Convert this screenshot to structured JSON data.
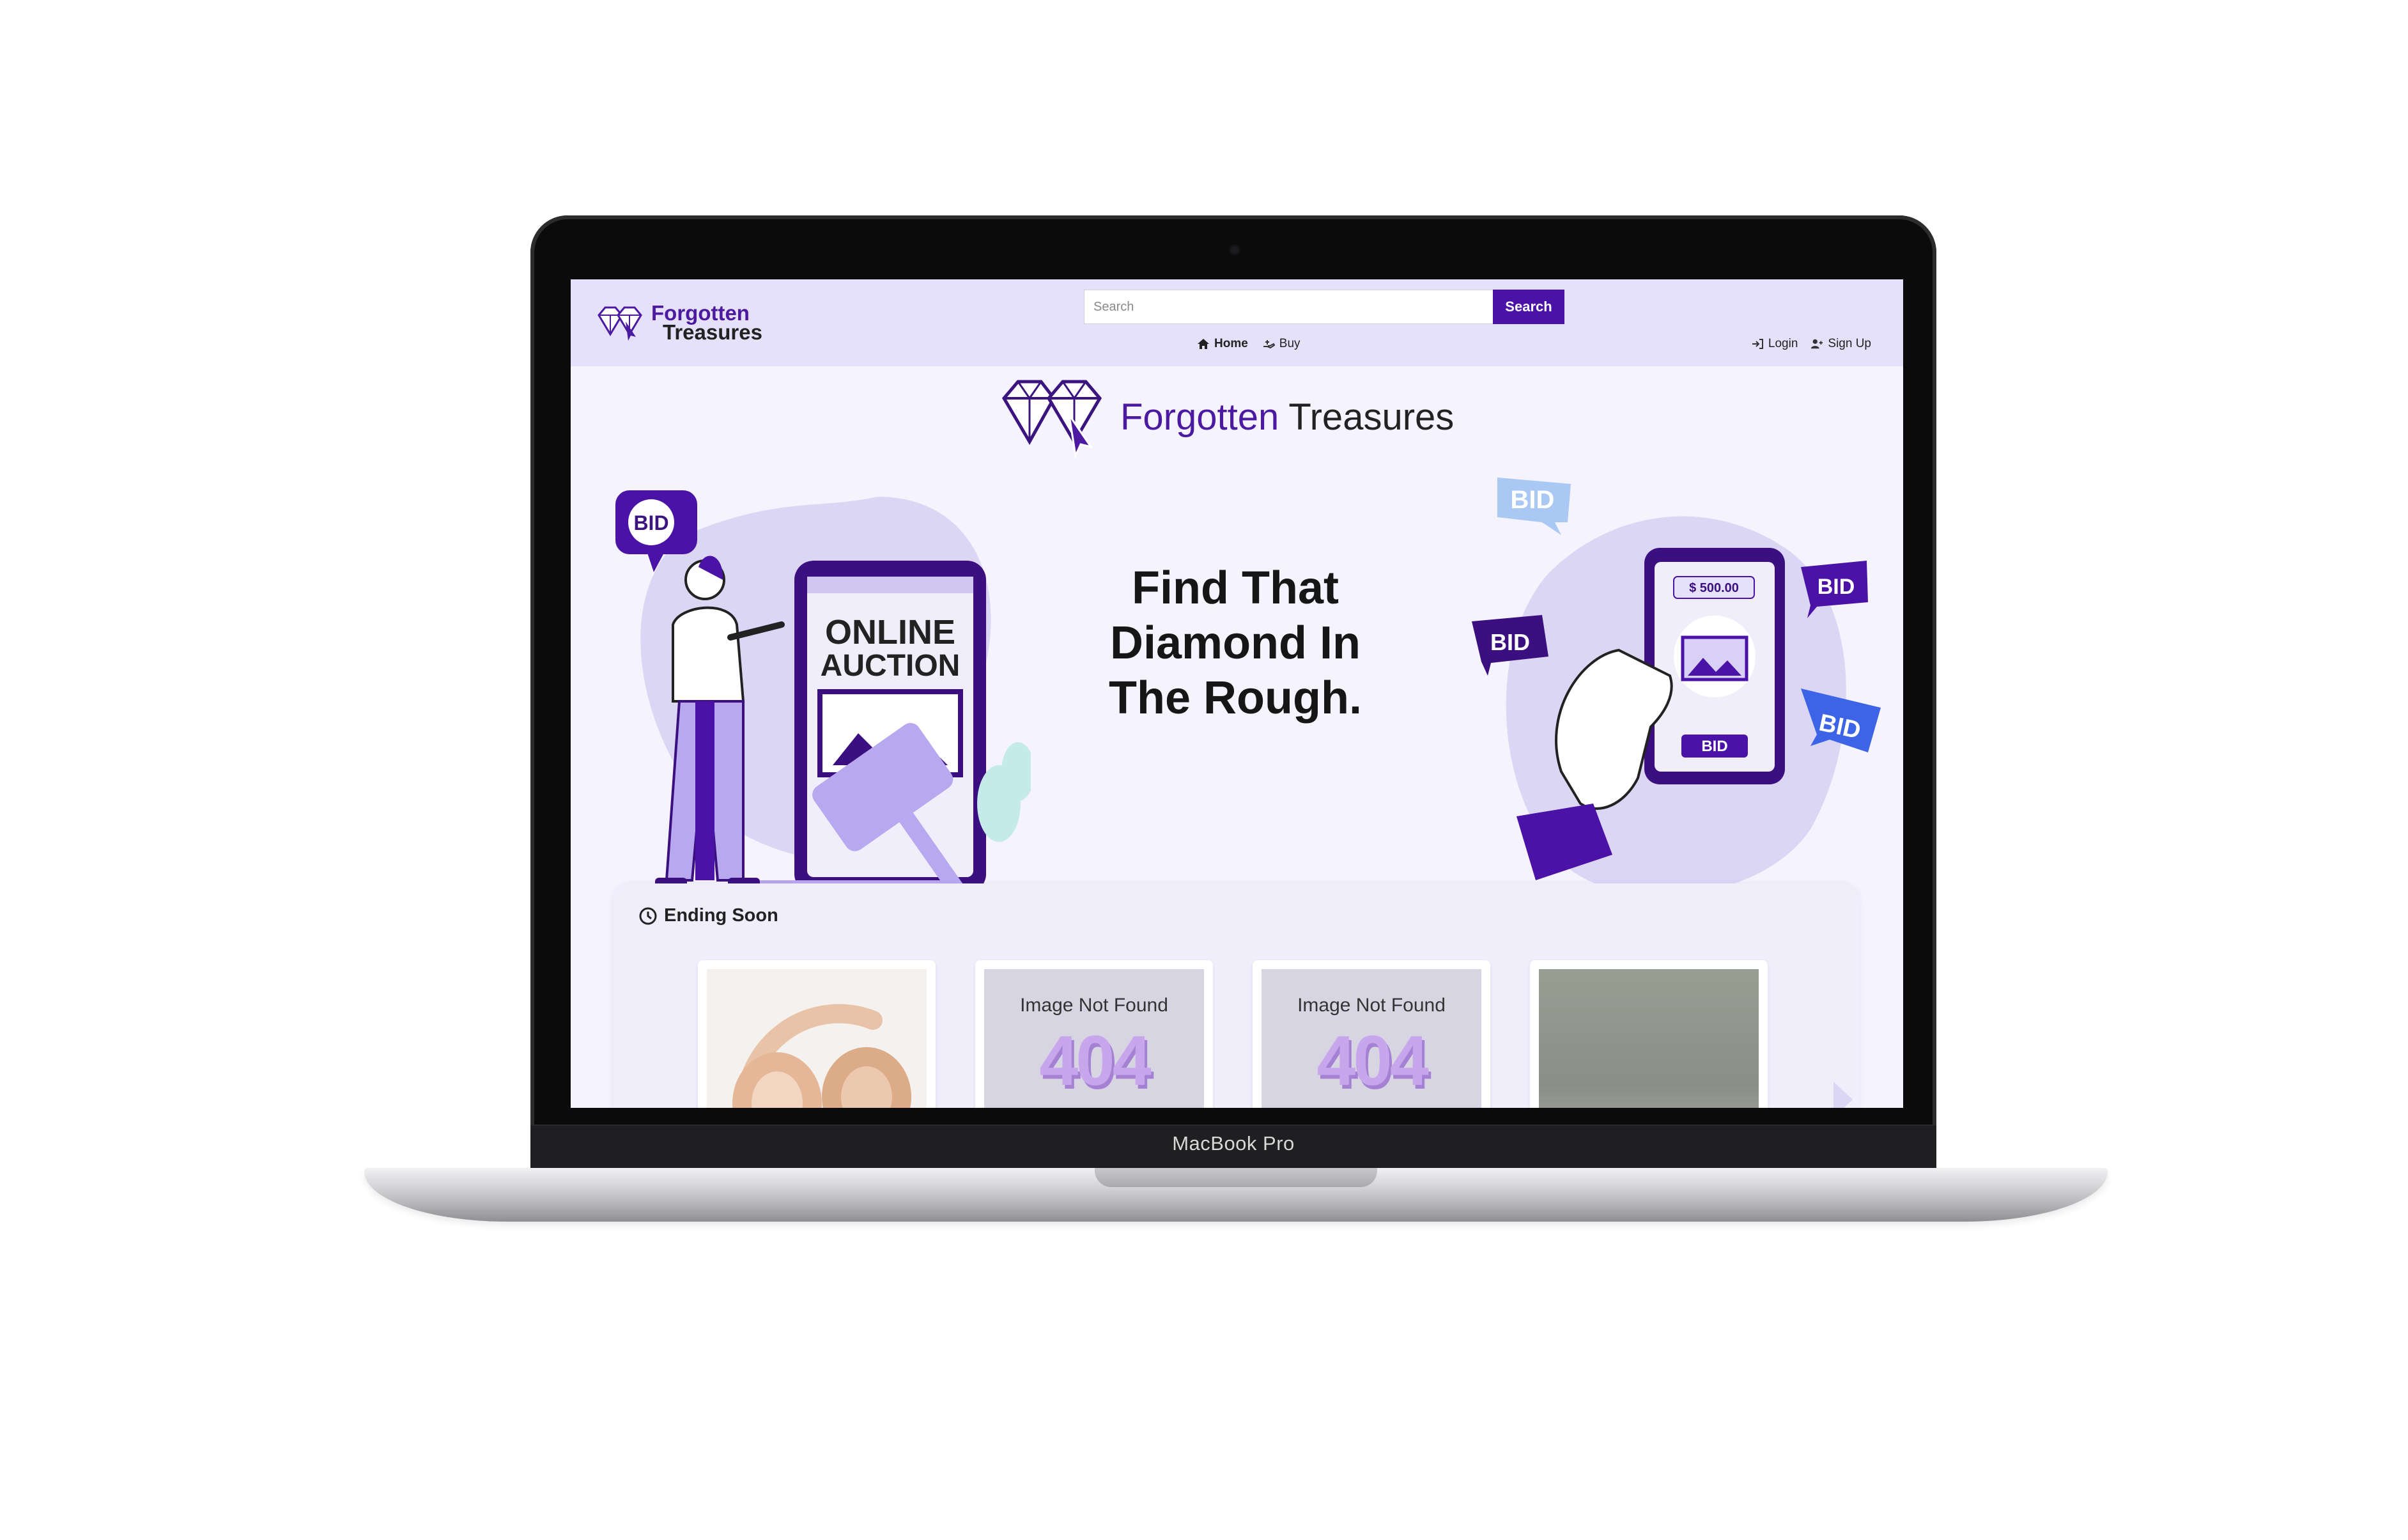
{
  "device": {
    "model_label": "MacBook Pro"
  },
  "site": {
    "logo_line1": "Forgotten",
    "logo_line2": "Treasures",
    "brand_word1": "Forgotten",
    "brand_word2": "Treasures"
  },
  "search": {
    "placeholder": "Search",
    "button_label": "Search"
  },
  "nav": {
    "links": [
      {
        "label": "Home",
        "icon": "home-icon",
        "active": true
      },
      {
        "label": "Buy",
        "icon": "hand-money-icon",
        "active": false
      }
    ],
    "auth": [
      {
        "label": "Login",
        "icon": "sign-in-icon"
      },
      {
        "label": "Sign Up",
        "icon": "user-plus-icon"
      }
    ]
  },
  "hero": {
    "title_lines": [
      "Find That",
      "Diamond In",
      "The Rough."
    ],
    "left_illustration": {
      "bubble": "BID",
      "phone_text_line1": "ONLINE",
      "phone_text_line2": "AUCTION"
    },
    "right_illustration": {
      "price": "$ 500.00",
      "bubbles": [
        "BID",
        "BID",
        "BID",
        "BID"
      ],
      "phone_button": "BID"
    }
  },
  "ending_soon": {
    "title": "Ending Soon",
    "icon": "clock-icon",
    "cards": [
      {
        "image": "headphones-photo"
      },
      {
        "image": "not-found",
        "label": "Image Not Found",
        "code": "404"
      },
      {
        "image": "not-found",
        "label": "Image Not Found",
        "code": "404"
      },
      {
        "image": "grey-photo"
      }
    ]
  },
  "colors": {
    "accent": "#4a12a6",
    "navbar": "#e5e1fa",
    "page_bg": "#f5f3fd",
    "lavender": "#b7a8f0"
  }
}
